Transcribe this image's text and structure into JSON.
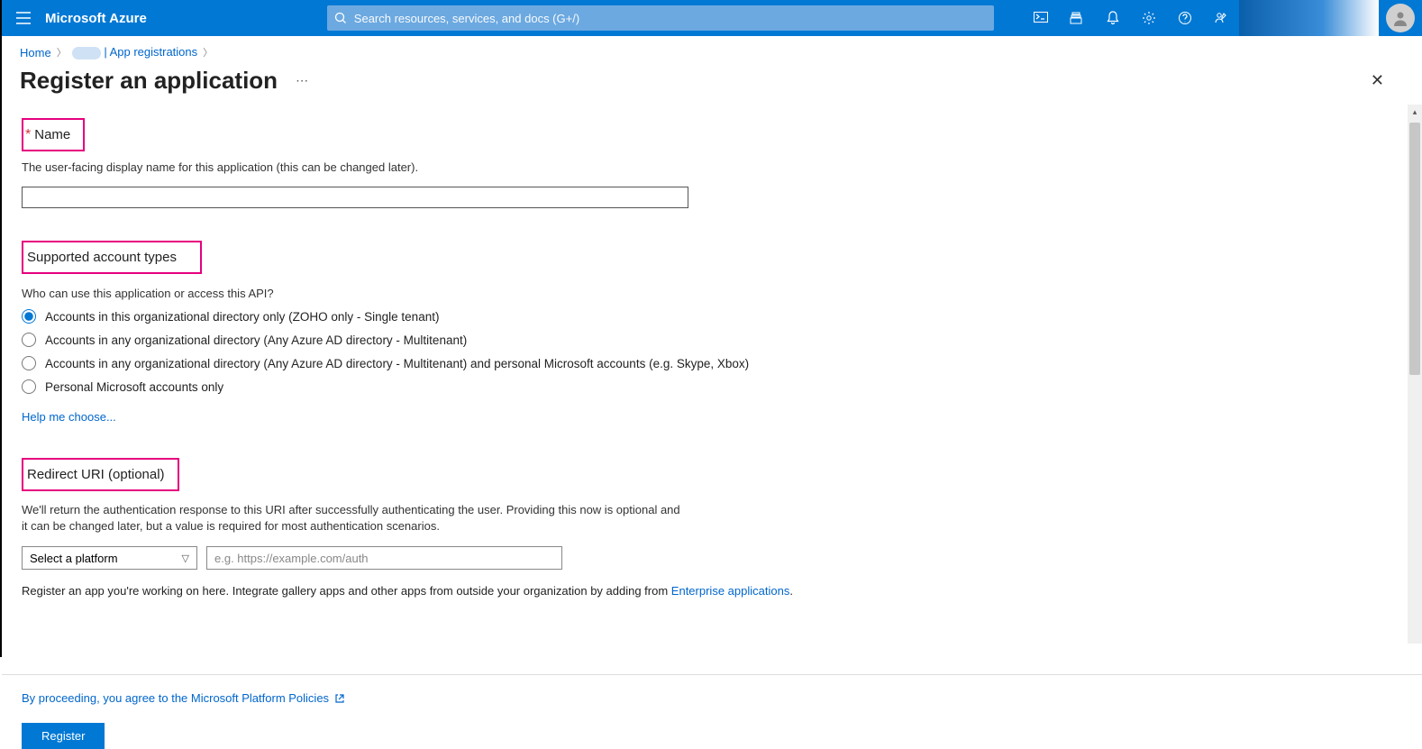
{
  "brand": "Microsoft Azure",
  "search": {
    "placeholder": "Search resources, services, and docs (G+/)"
  },
  "breadcrumb": {
    "home": "Home",
    "app_reg": "| App registrations"
  },
  "page": {
    "title": "Register an application"
  },
  "name_section": {
    "label": "Name",
    "desc": "The user-facing display name for this application (this can be changed later)."
  },
  "account_types": {
    "heading": "Supported account types",
    "question": "Who can use this application or access this API?",
    "options": [
      "Accounts in this organizational directory only (ZOHO only - Single tenant)",
      "Accounts in any organizational directory (Any Azure AD directory - Multitenant)",
      "Accounts in any organizational directory (Any Azure AD directory - Multitenant) and personal Microsoft accounts (e.g. Skype, Xbox)",
      "Personal Microsoft accounts only"
    ],
    "help": "Help me choose..."
  },
  "redirect": {
    "heading": "Redirect URI (optional)",
    "desc": "We'll return the authentication response to this URI after successfully authenticating the user. Providing this now is optional and it can be changed later, but a value is required for most authentication scenarios.",
    "platform_placeholder": "Select a platform",
    "uri_placeholder": "e.g. https://example.com/auth",
    "note_prefix": "Register an app you're working on here. Integrate gallery apps and other apps from outside your organization by adding from ",
    "note_link": "Enterprise applications"
  },
  "footer": {
    "policy": "By proceeding, you agree to the Microsoft Platform Policies",
    "register": "Register"
  }
}
